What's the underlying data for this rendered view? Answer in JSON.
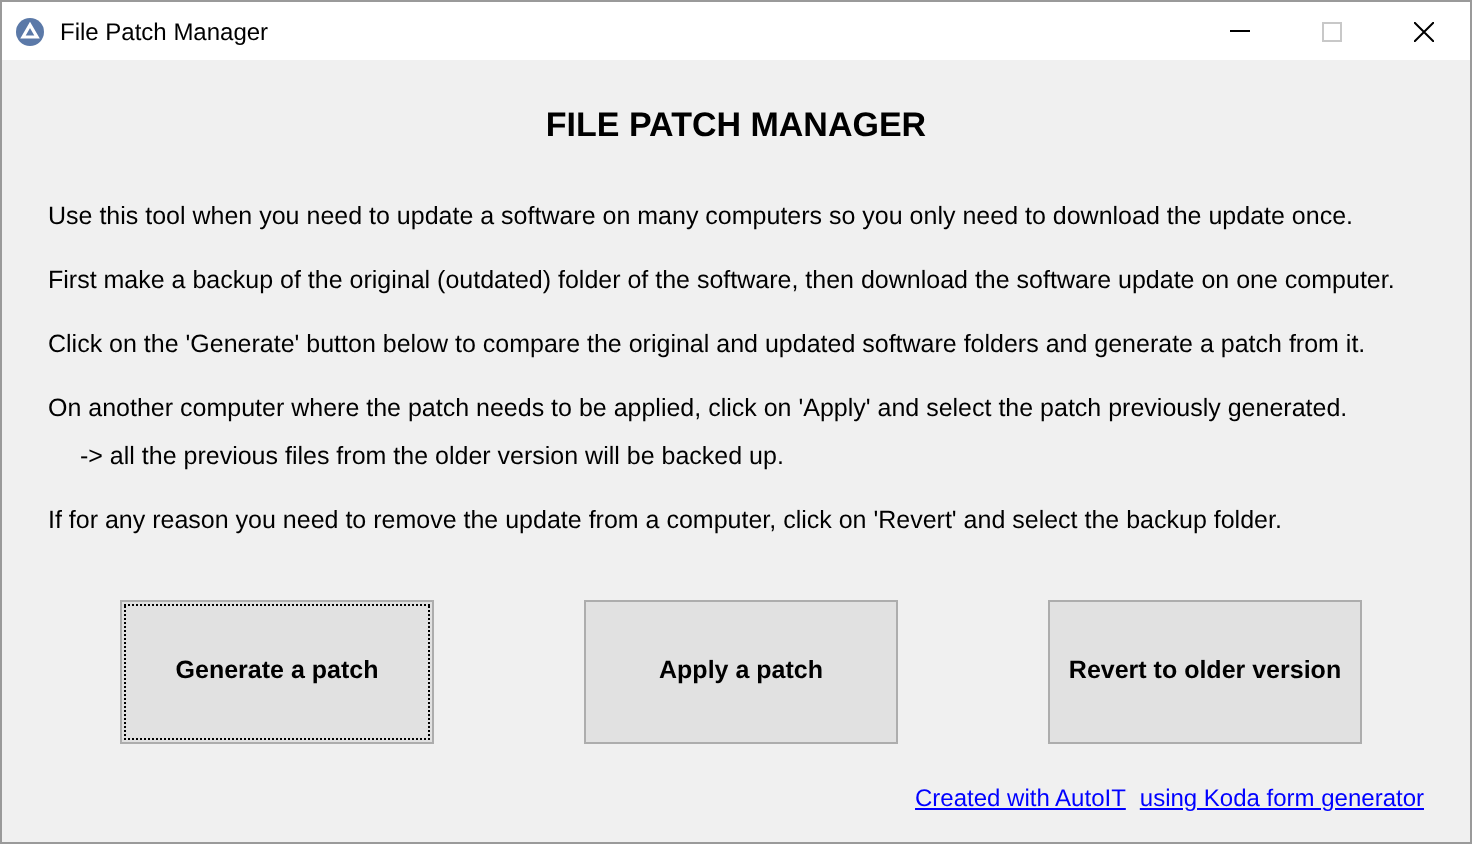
{
  "window": {
    "title": "File Patch Manager",
    "maximize_disabled": true
  },
  "heading": "FILE PATCH MANAGER",
  "paragraphs": [
    {
      "kind": "line",
      "text": "Use this tool when you need to update a software on many computers so you only need to download the update once."
    },
    {
      "kind": "line",
      "text": "First make a backup of the original (outdated) folder of the software, then download the software update on one computer."
    },
    {
      "kind": "line",
      "text": "Click on the 'Generate' button below to compare the original and updated software folders and generate a patch from it."
    },
    {
      "kind": "line",
      "text": "On another computer where the patch needs to be applied, click on 'Apply' and select the patch previously generated."
    },
    {
      "kind": "sub",
      "text": "-> all the previous files from the older version will be backed up."
    },
    {
      "kind": "line",
      "text": "If for any reason you need to remove the update from a computer, click on 'Revert' and select the backup folder."
    }
  ],
  "buttons": [
    {
      "label": "Generate a patch",
      "focused": true
    },
    {
      "label": "Apply a patch",
      "focused": false
    },
    {
      "label": "Revert to older version",
      "focused": false
    }
  ],
  "links": [
    "Created with AutoIT",
    "using Koda form generator"
  ]
}
